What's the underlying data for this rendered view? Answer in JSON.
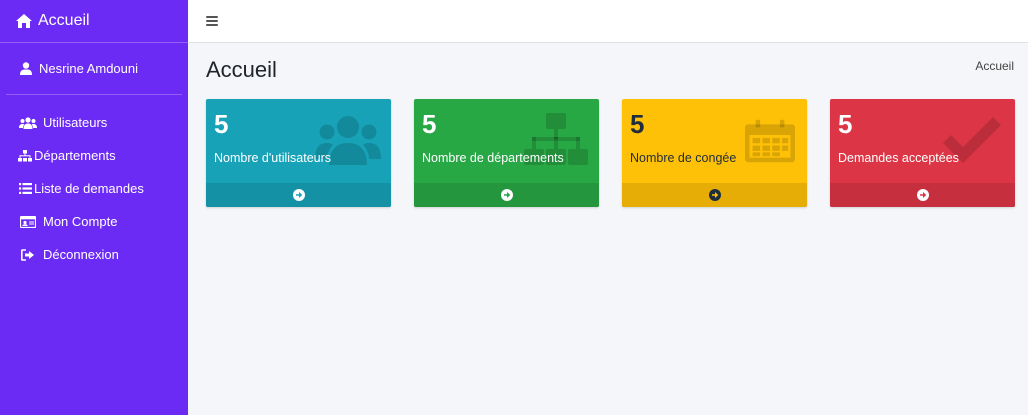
{
  "brand": {
    "title": "Accueil",
    "icon": "home-icon"
  },
  "user": {
    "name": "Nesrine Amdouni",
    "icon": "user-icon"
  },
  "nav": {
    "items": [
      {
        "label": "Utilisateurs",
        "icon": "users-icon"
      },
      {
        "label": "Départements",
        "icon": "sitemap-icon"
      },
      {
        "label": "Liste de demandes",
        "icon": "list-icon"
      },
      {
        "label": "Mon Compte",
        "icon": "id-card-icon"
      },
      {
        "label": "Déconnexion",
        "icon": "sign-out-icon"
      }
    ]
  },
  "page": {
    "title": "Accueil",
    "breadcrumb": "Accueil"
  },
  "cards": [
    {
      "count": "5",
      "label": "Nombre d'utilisateurs",
      "icon": "users-icon",
      "color": "#17a2b8"
    },
    {
      "count": "5",
      "label": "Nombre de départements",
      "icon": "sitemap-icon",
      "color": "#28a745"
    },
    {
      "count": "5",
      "label": "Nombre de congée",
      "icon": "calendar-icon",
      "color": "#ffc107"
    },
    {
      "count": "5",
      "label": "Demandes acceptées",
      "icon": "check-icon",
      "color": "#dc3545"
    }
  ],
  "colors": {
    "sidebar": "#6c2bf5",
    "background": "#f4f6f9"
  }
}
